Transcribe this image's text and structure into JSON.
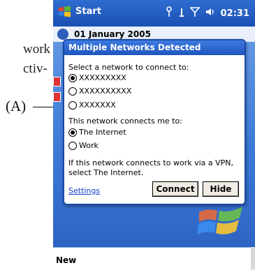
{
  "manual": {
    "line1": "work",
    "line2": "ctiv-",
    "callout": "(A)"
  },
  "statusbar": {
    "start_label": "Start",
    "time": "02:31"
  },
  "today": {
    "date": "01 January 2005"
  },
  "dialog": {
    "title": "Multiple Networks Detected",
    "prompt": "Select a network to connect to:",
    "networks": [
      {
        "label": "XXXXXXXXX",
        "selected": true
      },
      {
        "label": "XXXXXXXXXX",
        "selected": false
      },
      {
        "label": "XXXXXXX",
        "selected": false
      }
    ],
    "connects_prompt": "This network connects me to:",
    "destinations": [
      {
        "label": "The Internet",
        "selected": true
      },
      {
        "label": "Work",
        "selected": false
      }
    ],
    "info_line1": "If this network connects to work via a VPN,",
    "info_line2": "select The Internet.",
    "settings_link": "Settings",
    "connect_label": "Connect",
    "hide_label": "Hide"
  },
  "softkeys": {
    "left": "New"
  }
}
